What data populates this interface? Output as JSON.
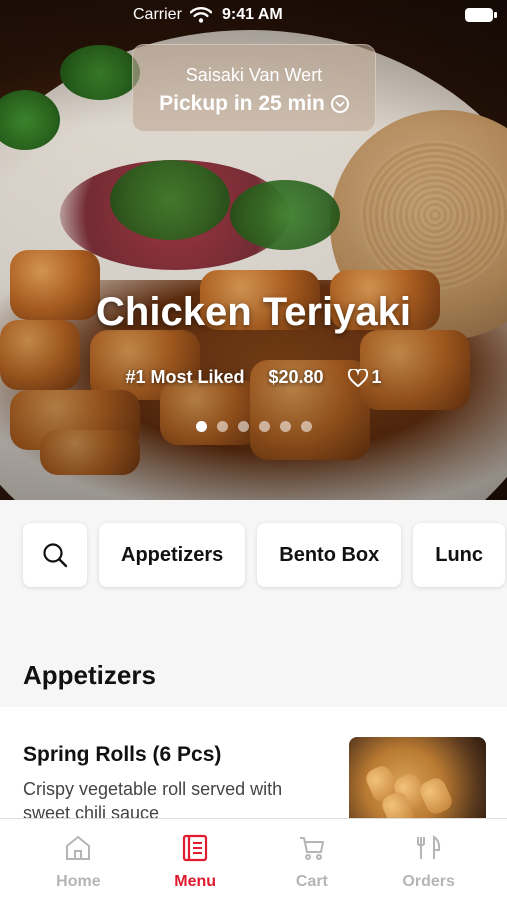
{
  "status_bar": {
    "carrier": "Carrier",
    "time": "9:41 AM"
  },
  "pickup": {
    "store_name": "Saisaki Van Wert",
    "eta_label": "Pickup in 25 min"
  },
  "featured": {
    "title": "Chicken Teriyaki",
    "badge": "#1 Most Liked",
    "price": "$20.80",
    "likes": "1",
    "carousel_count": 6,
    "carousel_active_index": 0
  },
  "categories": [
    "Appetizers",
    "Bento Box",
    "Lunc"
  ],
  "section": {
    "title": "Appetizers"
  },
  "menu_items": [
    {
      "name": "Spring Rolls (6 Pcs)",
      "description": "Crispy vegetable roll served with sweet chili sauce"
    }
  ],
  "tabs": [
    {
      "label": "Home",
      "icon": "home-icon",
      "active": false
    },
    {
      "label": "Menu",
      "icon": "menu-icon",
      "active": true
    },
    {
      "label": "Cart",
      "icon": "cart-icon",
      "active": false
    },
    {
      "label": "Orders",
      "icon": "orders-icon",
      "active": false
    }
  ],
  "colors": {
    "accent": "#e01b2f",
    "inactive_tab": "#b5b5b5"
  }
}
